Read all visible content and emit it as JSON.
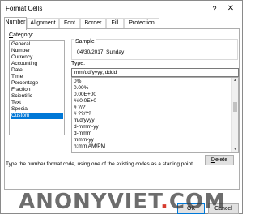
{
  "window": {
    "title": "Format Cells",
    "help": "?",
    "close": "✕"
  },
  "tabs": [
    "Number",
    "Alignment",
    "Font",
    "Border",
    "Fill",
    "Protection"
  ],
  "category": {
    "label_first": "C",
    "label_rest": "ategory:",
    "items": [
      "General",
      "Number",
      "Currency",
      "Accounting",
      "Date",
      "Time",
      "Percentage",
      "Fraction",
      "Scientific",
      "Text",
      "Special",
      "Custom"
    ],
    "selected": "Custom"
  },
  "sample": {
    "label": "Sample",
    "value": "04/30/2017, Sunday"
  },
  "type_field": {
    "label_first": "T",
    "label_rest": "ype:",
    "value": "mm/dd/yyyy, dddd"
  },
  "formats": [
    "0%",
    "0.00%",
    "0.00E+00",
    "##0.0E+0",
    "# ?/?",
    "# ??/??",
    "m/d/yyyy",
    "d-mmm-yy",
    "d-mmm",
    "mmm-yy",
    "h:mm AM/PM"
  ],
  "buttons": {
    "delete_first": "D",
    "delete_rest": "elete",
    "ok": "OK",
    "cancel": "Cancel"
  },
  "hint": "Type the number format code, using one of the existing codes as a starting point.",
  "watermark": {
    "part1": "ANONYVIET",
    "dot": ".",
    "part2": "COM"
  }
}
